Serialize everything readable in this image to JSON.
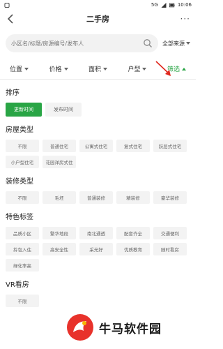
{
  "status": {
    "time": "10:06",
    "network": "5G"
  },
  "header": {
    "back_label": "‹",
    "title": "二手房",
    "more_label": "···"
  },
  "search": {
    "placeholder": "小区名/标题/房源编号/发布人",
    "source_label": "全部来源"
  },
  "filters": [
    {
      "label": "位置"
    },
    {
      "label": "价格"
    },
    {
      "label": "面积"
    },
    {
      "label": "户型"
    },
    {
      "label": "筛选"
    }
  ],
  "sections": {
    "sort": {
      "title": "排序",
      "options": [
        "更新时间",
        "发布时间"
      ]
    },
    "house_type": {
      "title": "房屋类型",
      "options": [
        "不限",
        "普通住宅",
        "公寓式住宅",
        "复式住宅",
        "跃层式住宅",
        "小户型住宅",
        "花园洋房式住"
      ]
    },
    "decoration": {
      "title": "装修类型",
      "options": [
        "不限",
        "毛坯",
        "普通装修",
        "精装修",
        "豪华装修"
      ]
    },
    "features": {
      "title": "特色标签",
      "options": [
        "品质小区",
        "繁华地段",
        "南北通透",
        "配套齐全",
        "交通便利",
        "拎包入住",
        "高安全性",
        "采光好",
        "优质教育",
        "随时看房",
        "绿化率高"
      ]
    },
    "vr": {
      "title": "VR看房",
      "options": [
        "不限"
      ]
    }
  },
  "watermark": {
    "text": "牛马软件园"
  },
  "colors": {
    "accent": "#29a545",
    "chip_bg": "#f3f3f3",
    "annotation": "#e0281e"
  }
}
